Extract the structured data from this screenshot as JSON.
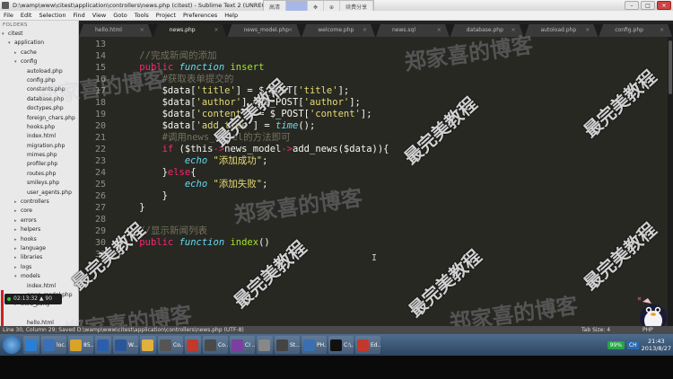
{
  "window": {
    "title": "D:\\wamp\\www\\citest\\application\\controllers\\news.php (citest) - Sublime Text 2 (UNREG",
    "controls": [
      "–",
      "□",
      "✕"
    ]
  },
  "overlay_toolbar": {
    "items": [
      "高清",
      "",
      "✥",
      "⊕",
      "续费分享"
    ]
  },
  "menu": [
    "File",
    "Edit",
    "Selection",
    "Find",
    "View",
    "Goto",
    "Tools",
    "Project",
    "Preferences",
    "Help"
  ],
  "sidebar": {
    "label": "FOLDERS",
    "items": [
      {
        "label": "citest",
        "indent": 0,
        "arrow": "▾"
      },
      {
        "label": "application",
        "indent": 1,
        "arrow": "▾"
      },
      {
        "label": "cache",
        "indent": 2,
        "arrow": "▸"
      },
      {
        "label": "config",
        "indent": 2,
        "arrow": "▾"
      },
      {
        "label": "autoload.php",
        "indent": 3,
        "arrow": ""
      },
      {
        "label": "config.php",
        "indent": 3,
        "arrow": ""
      },
      {
        "label": "constants.php",
        "indent": 3,
        "arrow": ""
      },
      {
        "label": "database.php",
        "indent": 3,
        "arrow": ""
      },
      {
        "label": "doctypes.php",
        "indent": 3,
        "arrow": ""
      },
      {
        "label": "foreign_chars.php",
        "indent": 3,
        "arrow": ""
      },
      {
        "label": "hooks.php",
        "indent": 3,
        "arrow": ""
      },
      {
        "label": "index.html",
        "indent": 3,
        "arrow": ""
      },
      {
        "label": "migration.php",
        "indent": 3,
        "arrow": ""
      },
      {
        "label": "mimes.php",
        "indent": 3,
        "arrow": ""
      },
      {
        "label": "profiler.php",
        "indent": 3,
        "arrow": ""
      },
      {
        "label": "routes.php",
        "indent": 3,
        "arrow": ""
      },
      {
        "label": "smileys.php",
        "indent": 3,
        "arrow": ""
      },
      {
        "label": "user_agents.php",
        "indent": 3,
        "arrow": ""
      },
      {
        "label": "controllers",
        "indent": 2,
        "arrow": "▸"
      },
      {
        "label": "core",
        "indent": 2,
        "arrow": "▸"
      },
      {
        "label": "errors",
        "indent": 2,
        "arrow": "▸"
      },
      {
        "label": "helpers",
        "indent": 2,
        "arrow": "▸"
      },
      {
        "label": "hooks",
        "indent": 2,
        "arrow": "▸"
      },
      {
        "label": "language",
        "indent": 2,
        "arrow": "▸"
      },
      {
        "label": "libraries",
        "indent": 2,
        "arrow": "▸"
      },
      {
        "label": "logs",
        "indent": 2,
        "arrow": "▸"
      },
      {
        "label": "models",
        "indent": 2,
        "arrow": "▾"
      },
      {
        "label": "index.html",
        "indent": 3,
        "arrow": ""
      },
      {
        "label": "news_model.php",
        "indent": 3,
        "arrow": ""
      },
      {
        "label": "third_party",
        "indent": 2,
        "arrow": "▸"
      },
      {
        "label": "",
        "indent": 2,
        "arrow": ""
      },
      {
        "label": "hello.html",
        "indent": 3,
        "arrow": ""
      }
    ],
    "recorder": {
      "time": "02:13:32",
      "sep": "▲",
      "count": "90"
    }
  },
  "tabs": [
    {
      "label": "hello.html",
      "active": false
    },
    {
      "label": "news.php",
      "active": true
    },
    {
      "label": "news_model.php",
      "active": false
    },
    {
      "label": "welcome.php",
      "active": false
    },
    {
      "label": "news.sql",
      "active": false
    },
    {
      "label": "database.php",
      "active": false
    },
    {
      "label": "autoload.php",
      "active": false
    },
    {
      "label": "config.php",
      "active": false
    }
  ],
  "editor": {
    "lines": [
      {
        "num": "13",
        "tokens": []
      },
      {
        "num": "14",
        "tokens": [
          {
            "t": "    ",
            "c": "pl"
          },
          {
            "t": "//完成新闻的添加",
            "c": "cm"
          }
        ]
      },
      {
        "num": "15",
        "tokens": [
          {
            "t": "    ",
            "c": "pl"
          },
          {
            "t": "public",
            "c": "kw"
          },
          {
            "t": " ",
            "c": "pl"
          },
          {
            "t": "function",
            "c": "st"
          },
          {
            "t": " ",
            "c": "pl"
          },
          {
            "t": "insert",
            "c": "fn"
          }
        ]
      },
      {
        "num": "16",
        "tokens": [
          {
            "t": "        ",
            "c": "pl"
          },
          {
            "t": "#获取表单提交的",
            "c": "cm"
          }
        ]
      },
      {
        "num": "17",
        "tokens": [
          {
            "t": "        ",
            "c": "pl"
          },
          {
            "t": "$data[",
            "c": "vr"
          },
          {
            "t": "'title'",
            "c": "str"
          },
          {
            "t": "] = $_POST[",
            "c": "vr"
          },
          {
            "t": "'title'",
            "c": "str"
          },
          {
            "t": "];",
            "c": "vr"
          }
        ]
      },
      {
        "num": "18",
        "tokens": [
          {
            "t": "        ",
            "c": "pl"
          },
          {
            "t": "$data[",
            "c": "vr"
          },
          {
            "t": "'author'",
            "c": "str"
          },
          {
            "t": "] = $_POST[",
            "c": "vr"
          },
          {
            "t": "'author'",
            "c": "str"
          },
          {
            "t": "];",
            "c": "vr"
          }
        ]
      },
      {
        "num": "19",
        "tokens": [
          {
            "t": "        ",
            "c": "pl"
          },
          {
            "t": "$data[",
            "c": "vr"
          },
          {
            "t": "'content'",
            "c": "str"
          },
          {
            "t": "] = $_POST[",
            "c": "vr"
          },
          {
            "t": "'content'",
            "c": "str"
          },
          {
            "t": "];",
            "c": "vr"
          }
        ]
      },
      {
        "num": "20",
        "tokens": [
          {
            "t": "        ",
            "c": "pl"
          },
          {
            "t": "$data[",
            "c": "vr"
          },
          {
            "t": "'add_time'",
            "c": "str"
          },
          {
            "t": "] = ",
            "c": "vr"
          },
          {
            "t": "time",
            "c": "st"
          },
          {
            "t": "();",
            "c": "vr"
          }
        ]
      },
      {
        "num": "21",
        "tokens": [
          {
            "t": "        ",
            "c": "pl"
          },
          {
            "t": "#调用news_model的方法即可",
            "c": "cm"
          }
        ]
      },
      {
        "num": "22",
        "tokens": [
          {
            "t": "        ",
            "c": "pl"
          },
          {
            "t": "if",
            "c": "kw"
          },
          {
            "t": " ($this",
            "c": "vr"
          },
          {
            "t": "->",
            "c": "kw"
          },
          {
            "t": "news_model",
            "c": "vr"
          },
          {
            "t": "->",
            "c": "kw"
          },
          {
            "t": "add_news($data)){",
            "c": "vr"
          }
        ]
      },
      {
        "num": "23",
        "tokens": [
          {
            "t": "            ",
            "c": "pl"
          },
          {
            "t": "echo",
            "c": "st"
          },
          {
            "t": " ",
            "c": "pl"
          },
          {
            "t": "\"添加成功\"",
            "c": "str"
          },
          {
            "t": ";",
            "c": "vr"
          }
        ]
      },
      {
        "num": "24",
        "tokens": [
          {
            "t": "        ",
            "c": "pl"
          },
          {
            "t": "}",
            "c": "vr"
          },
          {
            "t": "else",
            "c": "kw"
          },
          {
            "t": "{",
            "c": "vr"
          }
        ]
      },
      {
        "num": "25",
        "tokens": [
          {
            "t": "            ",
            "c": "pl"
          },
          {
            "t": "echo",
            "c": "st"
          },
          {
            "t": " ",
            "c": "pl"
          },
          {
            "t": "\"添加失败\"",
            "c": "str"
          },
          {
            "t": ";",
            "c": "vr"
          }
        ]
      },
      {
        "num": "26",
        "tokens": [
          {
            "t": "        ",
            "c": "pl"
          },
          {
            "t": "}",
            "c": "vr"
          }
        ]
      },
      {
        "num": "27",
        "tokens": [
          {
            "t": "    ",
            "c": "pl"
          },
          {
            "t": "}",
            "c": "vr"
          }
        ]
      },
      {
        "num": "28",
        "tokens": []
      },
      {
        "num": "29",
        "tokens": [
          {
            "t": "    ",
            "c": "pl"
          },
          {
            "t": "//显示新闻列表",
            "c": "cm"
          }
        ]
      },
      {
        "num": "30",
        "tokens": [
          {
            "t": "    ",
            "c": "pl"
          },
          {
            "t": "public",
            "c": "kw"
          },
          {
            "t": " ",
            "c": "pl"
          },
          {
            "t": "function",
            "c": "st"
          },
          {
            "t": " ",
            "c": "pl"
          },
          {
            "t": "index",
            "c": "fn"
          },
          {
            "t": "()",
            "c": "vr"
          }
        ]
      },
      {
        "num": "31",
        "tokens": [
          {
            "t": "}",
            "c": "vr"
          }
        ]
      }
    ]
  },
  "watermarks": {
    "site": "郑家喜的博客",
    "brand": "最完美教程"
  },
  "statusbar": {
    "left": "Line 30, Column 29; Saved D:\\wamp\\www\\citest\\application\\controllers\\news.php (UTF-8)",
    "tab_size": "Tab Size: 4",
    "syntax": "PHP"
  },
  "taskbar": {
    "items": [
      {
        "label": "",
        "color": "#2a7fd4"
      },
      {
        "label": "loc...",
        "color": "#3b6fb6"
      },
      {
        "label": "85...",
        "color": "#d9a22b"
      },
      {
        "label": "",
        "color": "#2b5fae"
      },
      {
        "label": "W...",
        "color": "#2b579a"
      },
      {
        "label": "",
        "color": "#e0b040"
      },
      {
        "label": "Co...",
        "color": "#555"
      },
      {
        "label": "",
        "color": "#c0392b"
      },
      {
        "label": "Co...",
        "color": "#4a4a4a"
      },
      {
        "label": "CI ...",
        "color": "#7b3fa0"
      },
      {
        "label": "",
        "color": "#888"
      },
      {
        "label": "St...",
        "color": "#444"
      },
      {
        "label": "PH...",
        "color": "#3a6fb0"
      },
      {
        "label": "C:\\...",
        "color": "#111"
      },
      {
        "label": "Ed...",
        "color": "#c0392b"
      }
    ],
    "battery": "99%",
    "tray_text": "CH",
    "time": "21:43",
    "date": "2013/8/27"
  }
}
